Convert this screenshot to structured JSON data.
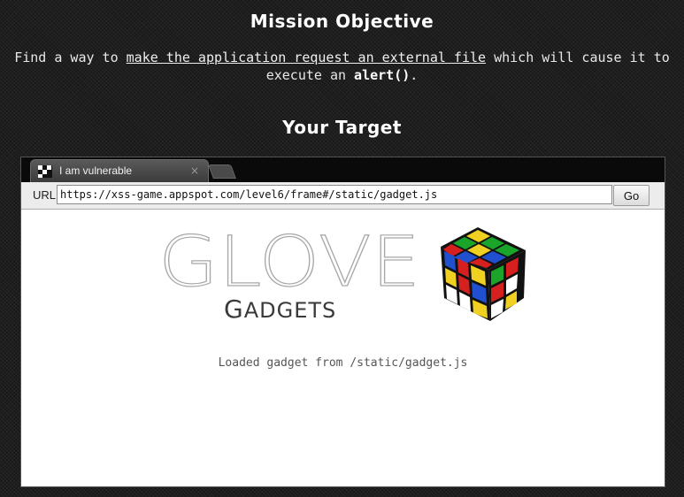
{
  "mission": {
    "heading": "Mission Objective",
    "text_before": "Find a way to ",
    "link_text": "make the application request an external file",
    "text_middle": " which will cause it to execute an ",
    "code": "alert()",
    "text_after": "."
  },
  "target": {
    "heading": "Your Target"
  },
  "browser": {
    "tab": {
      "title": "I am vulnerable",
      "close_symbol": "×",
      "favicon": "checkered-favicon-icon"
    },
    "urlbar": {
      "label": "URL",
      "value": "https://xss-game.appspot.com/level6/frame#/static/gadget.js",
      "go_label": "Go"
    },
    "page": {
      "logo_glove": "GLOVE",
      "logo_gadgets_initial": "G",
      "logo_gadgets_rest": "ADGETS",
      "cube_image": "rubiks-cube-icon",
      "status": "Loaded gadget from /static/gadget.js"
    }
  },
  "colors": {
    "background": "#1e1e1e",
    "heading": "#ffffff",
    "page_bg": "#ffffff",
    "cube_red": "#d62020",
    "cube_green": "#1aa52a",
    "cube_blue": "#2050d0",
    "cube_yellow": "#f0d020"
  }
}
